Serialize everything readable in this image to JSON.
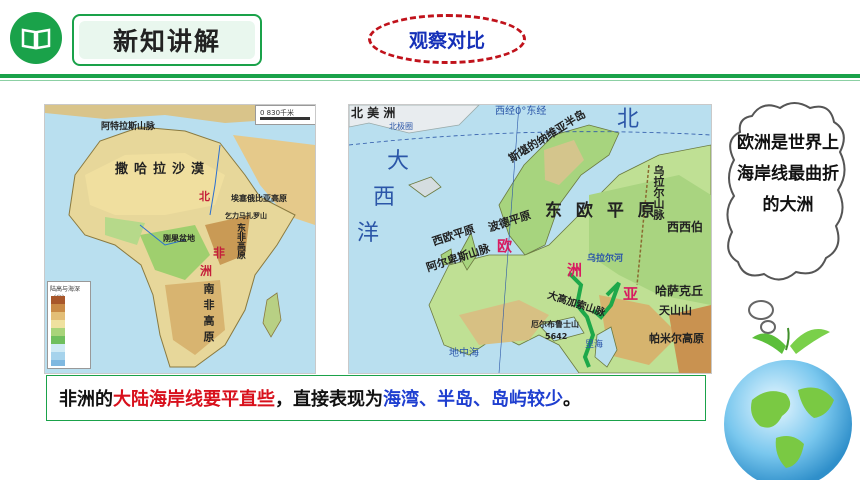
{
  "header": {
    "section_title": "新知讲解",
    "observe_label": "观察对比"
  },
  "africa_map": {
    "scale_label": "0   830千米",
    "legend_title": "陆高与海深（米）",
    "legend_values": [
      "5000",
      "2000",
      "1000",
      "500",
      "200",
      "0",
      "200",
      "2000",
      "4000",
      "5000"
    ],
    "labels": {
      "sahara": "撒哈拉沙漠",
      "atlas": "阿特拉斯山脉",
      "north": "北",
      "africa_fei": "非",
      "zhou": "洲",
      "ethiopia": "埃塞俄比亚高原",
      "south_high": "南非高原",
      "congo": "刚果盆地",
      "east_high": "东非高原",
      "kili": "乞力马扎罗山"
    }
  },
  "europe_map": {
    "labels": {
      "north_america": "北 美 洲",
      "greenland": "北极圈",
      "lon0": "西经0°东经",
      "north_ocean": "北",
      "scandinavia": "斯堪的纳维亚半岛",
      "atlantic_da": "大",
      "atlantic_xi": "西",
      "atlantic_yang": "洋",
      "east_plain": "东 欧 平 原",
      "west_plain": "西欧平原",
      "bodeplain": "波德平原",
      "europe_ou": "欧",
      "zhou": "洲",
      "ya": "亚",
      "alps": "阿尔卑斯山脉",
      "caucasus": "大高加索山脉",
      "elbrus": "厄尔布鲁士山",
      "elbrus_h": "5642",
      "ural": "乌拉尔山脉",
      "ural_river": "乌拉尔河",
      "west_siberia": "西西伯",
      "kazakh": "哈萨克丘",
      "tianshan": "天山山",
      "pamir": "帕米尔高原",
      "caspian": "里海",
      "mediterranean": "地中海"
    }
  },
  "caption": {
    "part1": "非洲的",
    "part2_red": "大陆海岸线要平直些",
    "part3": "，直接表现为",
    "part4_blue": "海湾、半岛、岛屿较少",
    "part5": "。"
  },
  "bubble": {
    "text": "欧洲是世界上海岸线最曲折的大洲"
  }
}
